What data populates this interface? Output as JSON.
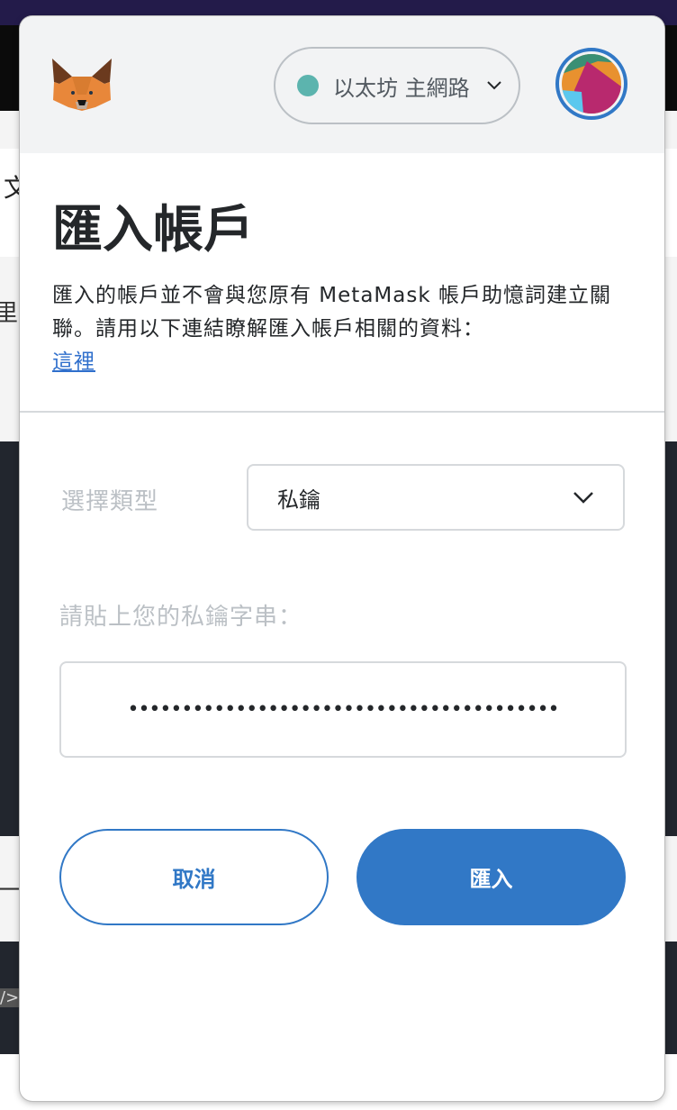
{
  "header": {
    "network_label": "以太坊 主網路",
    "network_color": "#5cb4ae"
  },
  "page": {
    "title": "匯入帳戶",
    "description": "匯入的帳戶並不會與您原有 MetaMask 帳戶助憶詞建立關聯。請用以下連結瞭解匯入帳戶相關的資料：",
    "link": "這裡"
  },
  "form": {
    "type_label": "選擇類型",
    "type_value": "私鑰",
    "key_label": "請貼上您的私鑰字串：",
    "key_value": "••••••••••••••••••••••••••••••••••••••••"
  },
  "buttons": {
    "cancel": "取消",
    "import": "匯入"
  },
  "background": {
    "char1": "文",
    "char2": "里 创",
    "char3": "一",
    "char4": "/>"
  }
}
